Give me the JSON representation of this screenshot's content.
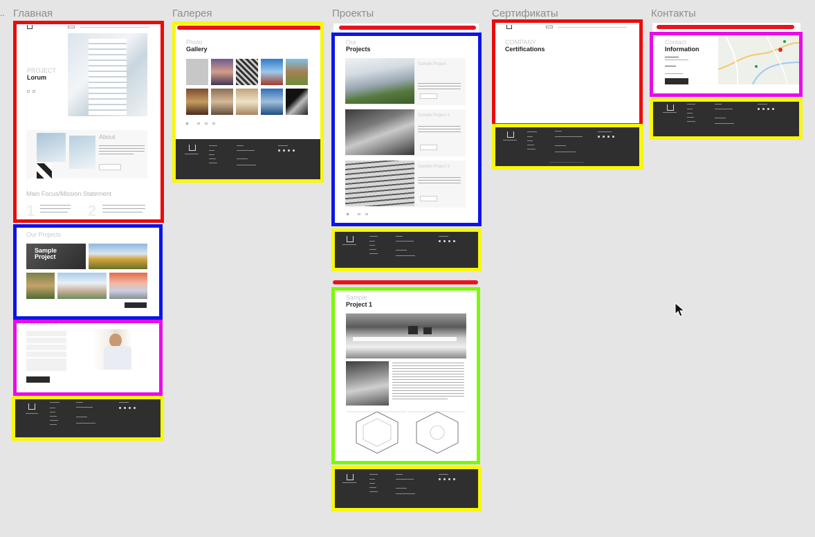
{
  "canvas": {
    "bg": "#e5e5e5",
    "overflow_marker": ".."
  },
  "frames": [
    {
      "title": "Главная"
    },
    {
      "title": "Галерея"
    },
    {
      "title": "Проекты"
    },
    {
      "title": "Сертификаты"
    },
    {
      "title": "Контакты"
    }
  ],
  "home": {
    "hero_light": "PROJECT",
    "hero_bold": "Lorum",
    "about_title": "About",
    "mission_title": "Main Focus/Mission Statement",
    "num1": "1",
    "num2": "2",
    "projects_title": "Our Projects",
    "sample_project": "Sample Project",
    "contact_title": "Contact Us"
  },
  "gallery": {
    "light": "Photo",
    "bold": "Gallery"
  },
  "projects": {
    "light": "Our",
    "bold": "Projects",
    "items": [
      {
        "title": "Sample Project"
      },
      {
        "title": "Sample Project 2"
      },
      {
        "title": "Sample Project 3"
      }
    ],
    "detail_light": "Sample",
    "detail_bold": "Project 1"
  },
  "certs": {
    "light": "COMPANY",
    "bold": "Certifications"
  },
  "contacts": {
    "light": "Contact",
    "bold": "Information"
  },
  "colors": {
    "red": "#ec0b0b",
    "blue": "#0b15e8",
    "magenta": "#ea0aea",
    "yellow": "#f7f70a",
    "green": "#7ef70a",
    "footer": "#2f2f2f"
  },
  "icons": [
    "cursor-arrow-icon",
    "logo-icon"
  ]
}
